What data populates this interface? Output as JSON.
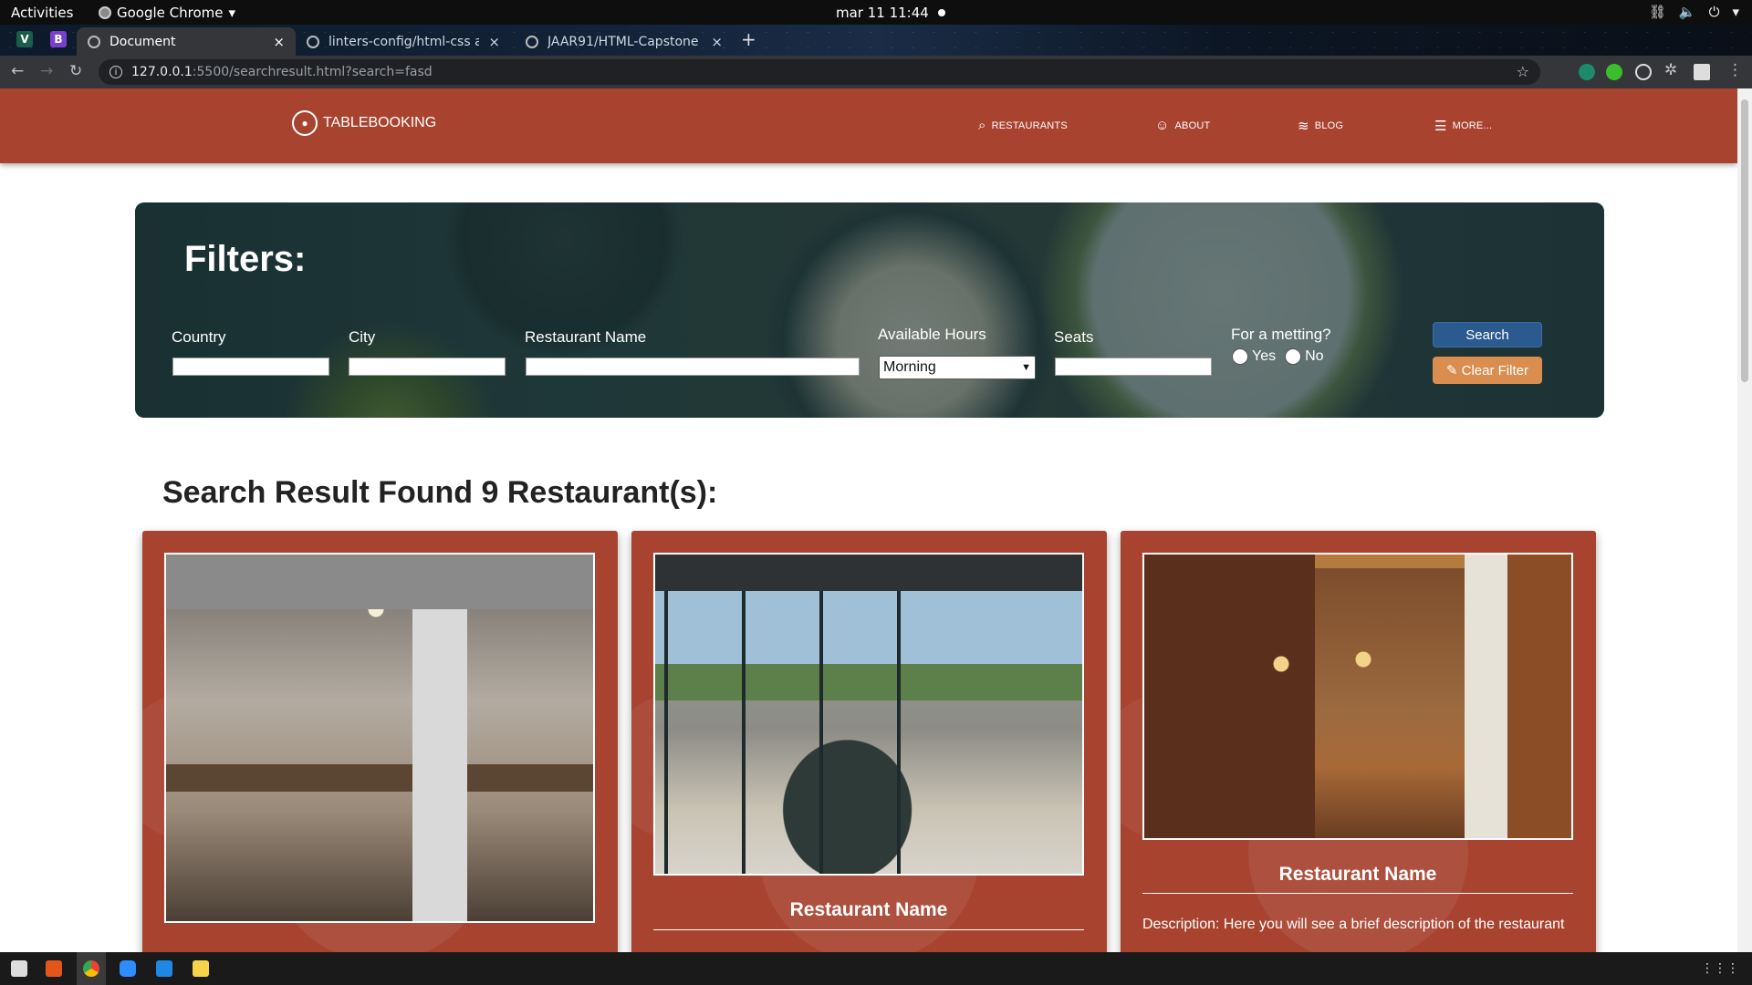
{
  "os": {
    "activities": "Activities",
    "app_name": "Google Chrome",
    "app_arrow": "▾",
    "clock": "mar 11  11:44",
    "tray_icons": [
      "network-icon",
      "volume-icon",
      "power-icon",
      "menu-arrow-icon"
    ]
  },
  "browser": {
    "tabs": [
      {
        "title": "Document",
        "active": true
      },
      {
        "title": "linters-config/html-css at",
        "active": false
      },
      {
        "title": "JAAR91/HTML-Capstone",
        "active": false
      }
    ],
    "close_glyph": "×",
    "new_tab_glyph": "+",
    "url_host": "127.0.0.1",
    "url_path": ":5500/searchresult.html?search=fasd"
  },
  "site": {
    "brand": "TABLEBOOKING",
    "nav": [
      {
        "label": "RESTAURANTS",
        "icon": "search-icon"
      },
      {
        "label": "ABOUT",
        "icon": "user-icon"
      },
      {
        "label": "BLOG",
        "icon": "rss-icon"
      },
      {
        "label": "MORE...",
        "icon": "menu-icon"
      }
    ]
  },
  "filters": {
    "title": "Filters:",
    "country_label": "Country",
    "city_label": "City",
    "restaurant_label": "Restaurant Name",
    "hours_label": "Available Hours",
    "hours_value": "Morning",
    "seats_label": "Seats",
    "meeting_label": "For a metting?",
    "yes_label": "Yes",
    "no_label": "No",
    "search_button": "Search",
    "clear_button": "Clear Filter"
  },
  "results": {
    "title": "Search Result Found 9 Restaurant(s):",
    "cards": [
      {
        "name": "",
        "description": ""
      },
      {
        "name": "Restaurant Name",
        "description": ""
      },
      {
        "name": "Restaurant Name",
        "description": "Description: Here you will see a brief description of the restaurant"
      }
    ]
  },
  "colors": {
    "brand_red": "#a84330",
    "search_blue": "#2a5a8e",
    "clear_orange": "#d98e4f"
  }
}
